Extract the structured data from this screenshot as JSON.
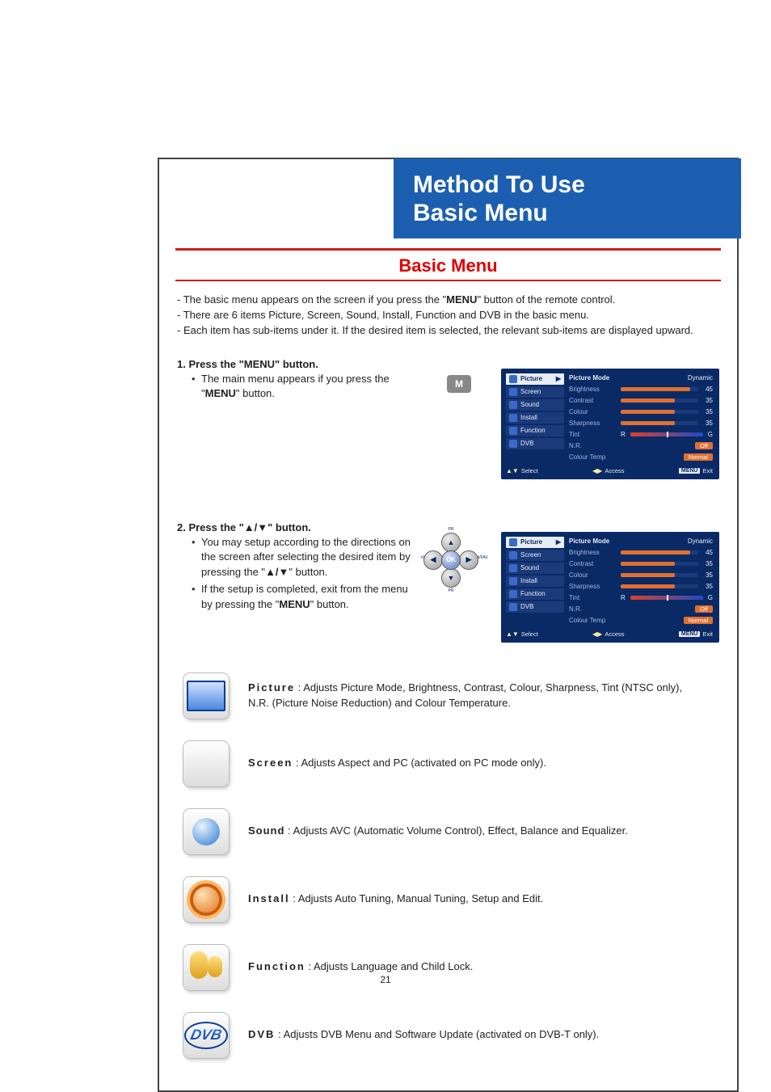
{
  "banner": {
    "line1": "Method To Use",
    "line2": "Basic Menu"
  },
  "section_title": "Basic Menu",
  "intro": {
    "l1_pre": "- The basic menu appears on the screen if you press the \"",
    "l1_strong": "MENU",
    "l1_post": "\" button of the remote control.",
    "l2": "- There are 6 items Picture, Screen, Sound, Install, Function and DVB in the basic menu.",
    "l3": "- Each item has sub-items under it. If the desired item is selected, the relevant sub-items are displayed upward."
  },
  "step1": {
    "heading": "1. Press the \"MENU\" button.",
    "body_pre": "The main menu appears if you press the \"",
    "body_strong": "MENU",
    "body_post": "\" button.",
    "m_btn": "M"
  },
  "step2": {
    "heading": "2. Press the \"▲/▼\" button.",
    "b1_pre": "You may setup according to the directions on the screen after selecting the desired item by pressing the \"",
    "b1_strong": "▲/▼",
    "b1_post": "\" button.",
    "b2_pre": "If the setup is completed, exit from the menu by pressing the \"",
    "b2_strong": "MENU",
    "b2_post": "\" button."
  },
  "osd": {
    "left": [
      "Picture",
      "Screen",
      "Sound",
      "Install",
      "Function",
      "DVB"
    ],
    "arrow": "▶",
    "right_rows": [
      {
        "lbl": "Picture Mode",
        "type": "text",
        "val": "Dynamic",
        "sel": true
      },
      {
        "lbl": "Brightness",
        "type": "bar",
        "pct": 90,
        "num": "45"
      },
      {
        "lbl": "Contrast",
        "type": "bar",
        "pct": 70,
        "num": "35"
      },
      {
        "lbl": "Colour",
        "type": "bar",
        "pct": 70,
        "num": "35"
      },
      {
        "lbl": "Sharpness",
        "type": "bar",
        "pct": 70,
        "num": "35"
      },
      {
        "lbl": "Tint",
        "type": "tint",
        "left": "R",
        "right": "G"
      },
      {
        "lbl": "N.R.",
        "type": "pill",
        "val": "Off"
      },
      {
        "lbl": "Colour Temp",
        "type": "pill",
        "val": "Normal"
      }
    ],
    "foot": {
      "select": "Select",
      "access": "Access",
      "exit": "Exit",
      "menu_chip": "MENU"
    }
  },
  "dpad": {
    "up": "▲",
    "down": "▼",
    "left": "◀",
    "right": "▶",
    "ok": "OK",
    "cap_top": "PR",
    "cap_right": "Vol/FAV",
    "cap_bottom": "PR",
    "cap_left": "Vol"
  },
  "menu_items": {
    "picture": {
      "name": "Picture",
      "sep": " : ",
      "desc": "Adjusts Picture Mode, Brightness, Contrast, Colour, Sharpness, Tint (NTSC only), N.R. (Picture Noise Reduction) and Colour Temperature."
    },
    "screen": {
      "name": "Screen",
      "sep": " : ",
      "desc": "Adjusts Aspect and PC (activated on PC mode only)."
    },
    "sound": {
      "name": "Sound",
      "sep": " : ",
      "desc": "Adjusts AVC (Automatic Volume Control), Effect, Balance and Equalizer."
    },
    "install": {
      "name": "Install",
      "sep": " : ",
      "desc": "Adjusts Auto Tuning, Manual Tuning, Setup and Edit."
    },
    "function": {
      "name": "Function",
      "sep": " : ",
      "desc": "Adjusts Language and Child Lock."
    },
    "dvb": {
      "name": "DVB",
      "sep": "  : ",
      "desc": "Adjusts DVB Menu and Software Update (activated on DVB-T only)."
    }
  },
  "page_number": "21"
}
